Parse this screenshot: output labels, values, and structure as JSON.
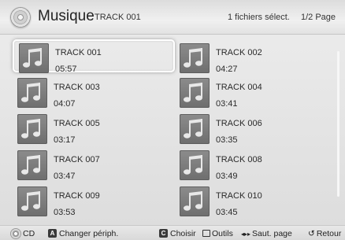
{
  "header": {
    "title": "Musique",
    "subtitle": "TRACK 001",
    "selection": "1 fichiers sélect.",
    "page": "1/2 Page"
  },
  "tracks": [
    {
      "name": "TRACK 001",
      "duration": "05:57"
    },
    {
      "name": "TRACK 002",
      "duration": "04:27"
    },
    {
      "name": "TRACK 003",
      "duration": "04:07"
    },
    {
      "name": "TRACK 004",
      "duration": "03:41"
    },
    {
      "name": "TRACK 005",
      "duration": "03:17"
    },
    {
      "name": "TRACK 006",
      "duration": "03:35"
    },
    {
      "name": "TRACK 007",
      "duration": "03:47"
    },
    {
      "name": "TRACK 008",
      "duration": "03:49"
    },
    {
      "name": "TRACK 009",
      "duration": "03:53"
    },
    {
      "name": "TRACK 010",
      "duration": "03:45"
    }
  ],
  "footer": {
    "cd": "CD",
    "key_a": "A",
    "change_device": "Changer périph.",
    "key_c": "C",
    "choose": "Choisir",
    "tools": "Outils",
    "skip_page_arrows": "◂▸▸",
    "skip_page": "Saut. page",
    "back_arrow": "↺",
    "back": "Retour"
  },
  "icons": {
    "header": "disc-icon",
    "track": "music-note-icon",
    "cd": "dpad-icon",
    "tools": "tools-icon",
    "back": "return-icon"
  },
  "colors": {
    "background": "#e4e4e4",
    "thumb": "#7a7a7a",
    "focus": "#ffffff"
  }
}
